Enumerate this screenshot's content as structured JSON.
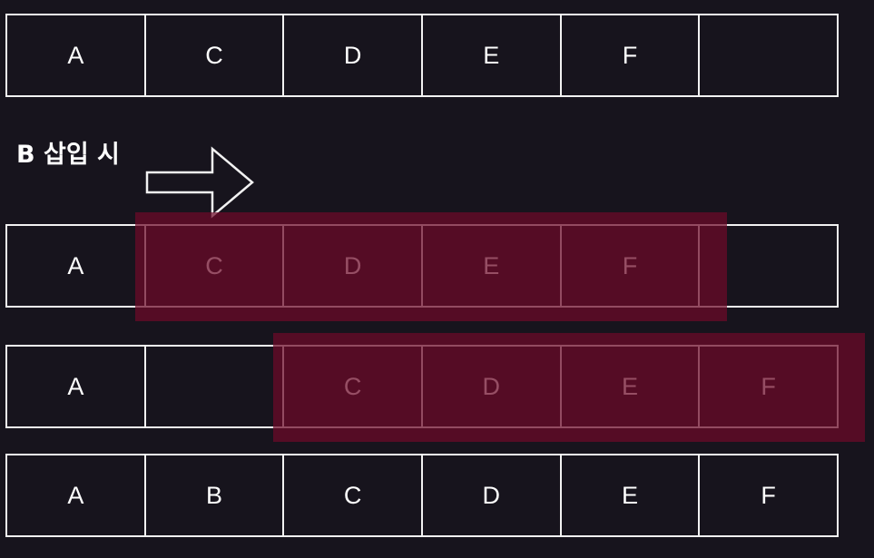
{
  "rows": [
    [
      "A",
      "C",
      "D",
      "E",
      "F",
      ""
    ],
    [
      "A",
      "C",
      "D",
      "E",
      "F",
      ""
    ],
    [
      "A",
      "",
      "C",
      "D",
      "E",
      "F"
    ],
    [
      "A",
      "B",
      "C",
      "D",
      "E",
      "F"
    ]
  ],
  "caption": "B 삽입 시",
  "colors": {
    "background": "#17141d",
    "cell_border": "#f2f2f2",
    "highlight": "#6e0a28"
  },
  "icons": {
    "arrow": "right-arrow-icon"
  }
}
